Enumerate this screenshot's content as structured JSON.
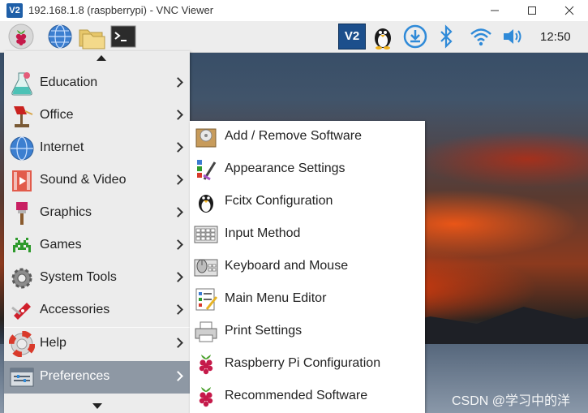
{
  "window": {
    "title": "192.168.1.8 (raspberrypi) - VNC Viewer",
    "logo_text": "V2"
  },
  "taskbar": {
    "clock": "12:50",
    "vnc_tray_text": "V2"
  },
  "main_menu": {
    "items": [
      {
        "label": "Education",
        "icon": "flask-icon"
      },
      {
        "label": "Office",
        "icon": "desk-lamp-icon"
      },
      {
        "label": "Internet",
        "icon": "globe-icon"
      },
      {
        "label": "Sound & Video",
        "icon": "film-icon"
      },
      {
        "label": "Graphics",
        "icon": "paintbrush-icon"
      },
      {
        "label": "Games",
        "icon": "space-invader-icon"
      },
      {
        "label": "System Tools",
        "icon": "gear-icon"
      },
      {
        "label": "Accessories",
        "icon": "swiss-knife-icon"
      },
      {
        "label": "Help",
        "icon": "lifebuoy-icon"
      },
      {
        "label": "Preferences",
        "icon": "preferences-icon"
      }
    ],
    "active": "Preferences"
  },
  "preferences_menu": {
    "items": [
      {
        "label": "Add / Remove Software",
        "icon": "package-icon"
      },
      {
        "label": "Appearance Settings",
        "icon": "palette-icon"
      },
      {
        "label": "Fcitx Configuration",
        "icon": "penguin-icon"
      },
      {
        "label": "Input Method",
        "icon": "keyboard-grid-icon"
      },
      {
        "label": "Keyboard and Mouse",
        "icon": "keyboard-mouse-icon"
      },
      {
        "label": "Main Menu Editor",
        "icon": "menu-editor-icon"
      },
      {
        "label": "Print Settings",
        "icon": "printer-icon"
      },
      {
        "label": "Raspberry Pi Configuration",
        "icon": "raspberry-icon"
      },
      {
        "label": "Recommended Software",
        "icon": "raspberry-icon"
      }
    ]
  },
  "watermark": "CSDN @学习中的洋",
  "colors": {
    "menu_bg": "#ececec",
    "submenu_bg": "#ffffff",
    "active_bg": "#8e98a4",
    "taskbar_bg": "#ededed"
  }
}
